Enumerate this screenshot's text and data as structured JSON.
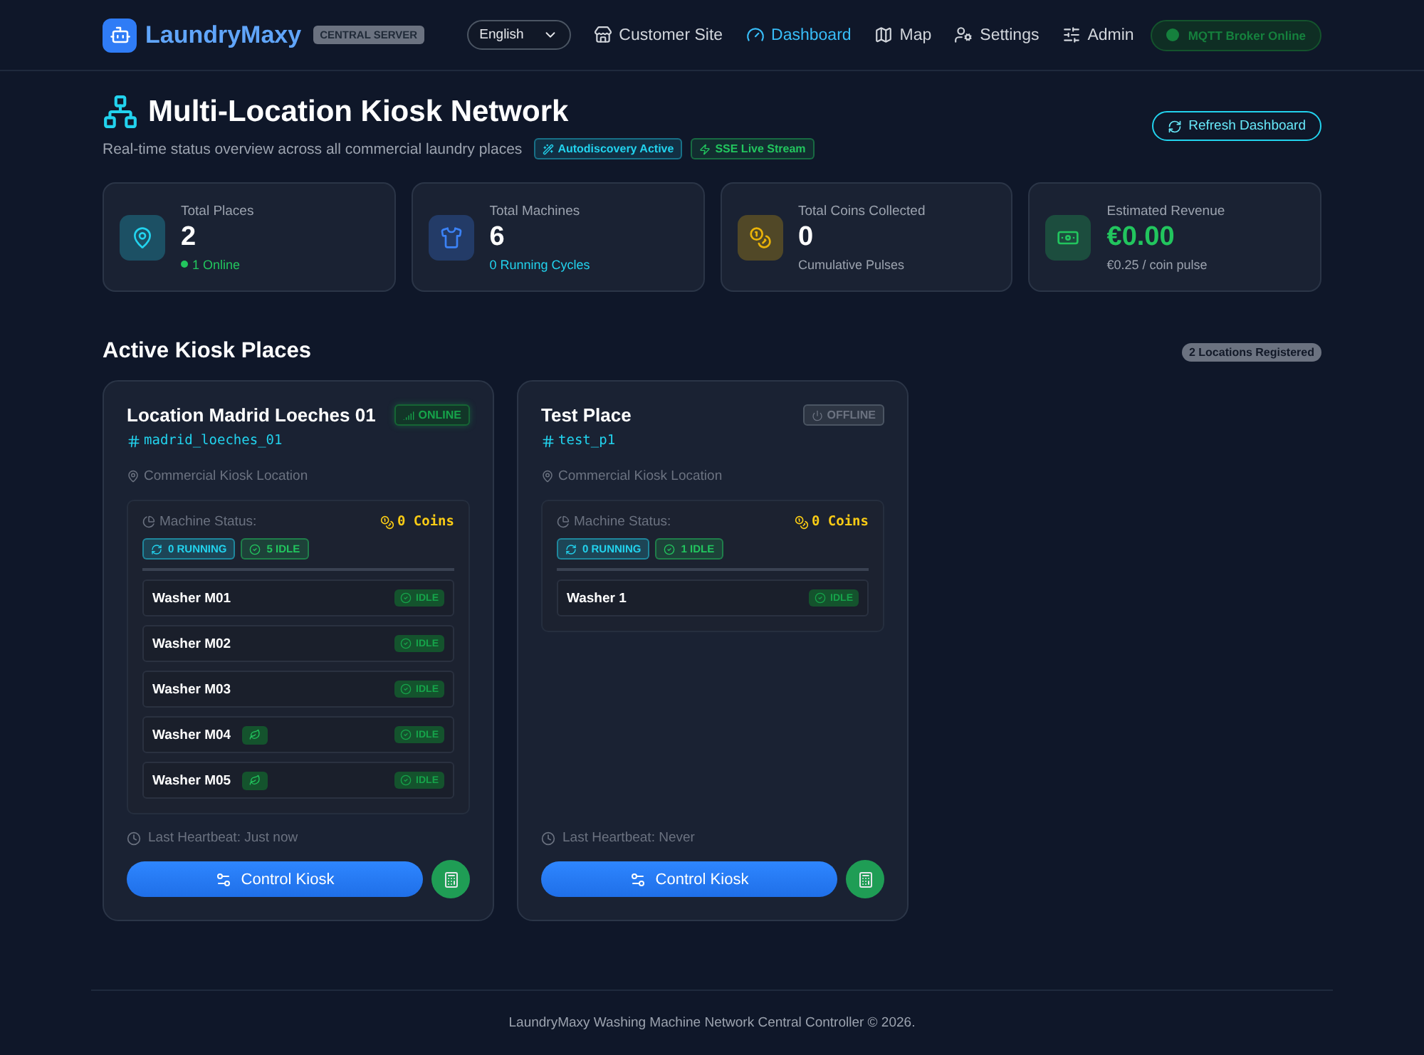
{
  "brand": {
    "name": "LaundryMaxy",
    "badge": "CENTRAL SERVER"
  },
  "language": {
    "value": "English"
  },
  "nav": [
    {
      "kind": "store",
      "label": "Customer Site",
      "selected": false
    },
    {
      "kind": "gauge",
      "label": "Dashboard",
      "selected": true
    },
    {
      "kind": "map",
      "label": "Map",
      "selected": false
    },
    {
      "kind": "settings",
      "label": "Settings",
      "selected": false
    },
    {
      "kind": "admin",
      "label": "Admin",
      "selected": false
    }
  ],
  "broker": {
    "label": "MQTT Broker Online",
    "online": true
  },
  "header": {
    "title": "Multi-Location Kiosk Network",
    "subtitle": "Real-time status overview across all commercial laundry places",
    "tags": [
      {
        "kind": "wand",
        "label": "Autodiscovery Active",
        "color": "#22d3ee"
      },
      {
        "kind": "zap",
        "label": "SSE Live Stream",
        "color": "#22c55e"
      }
    ],
    "refresh": "Refresh Dashboard"
  },
  "stats": [
    {
      "kind": "places",
      "label": "Total Places",
      "value": "2",
      "sub": "1 Online",
      "color": "#22d3ee"
    },
    {
      "kind": "machines",
      "label": "Total Machines",
      "value": "6",
      "sub": "0 Running Cycles",
      "color": "#3b82f6"
    },
    {
      "kind": "coins",
      "label": "Total Coins Collected",
      "value": "0",
      "sub": "Cumulative Pulses",
      "color": "#eab308"
    },
    {
      "kind": "revenue",
      "label": "Estimated Revenue",
      "value": "€0.00",
      "sub": "€0.25 / coin pulse",
      "color": "#22c55e"
    }
  ],
  "section": {
    "title": "Active Kiosk Places",
    "count": "2 Locations Registered"
  },
  "places": [
    {
      "name": "Location Madrid Loeches 01",
      "online": true,
      "status": "ONLINE",
      "id": "madrid_loeches_01",
      "location": "Commercial Kiosk Location",
      "machine_status": "Machine Status:",
      "coins": "0 Coins",
      "running": "0 RUNNING",
      "idle": "5 IDLE",
      "machines": [
        {
          "name": "Washer M01",
          "eco": false,
          "status": "IDLE"
        },
        {
          "name": "Washer M02",
          "eco": false,
          "status": "IDLE"
        },
        {
          "name": "Washer M03",
          "eco": false,
          "status": "IDLE"
        },
        {
          "name": "Washer M04",
          "eco": true,
          "status": "IDLE"
        },
        {
          "name": "Washer M05",
          "eco": true,
          "status": "IDLE"
        }
      ],
      "heartbeat": "Last Heartbeat: Just now",
      "control": "Control Kiosk"
    },
    {
      "name": "Test Place",
      "online": false,
      "status": "OFFLINE",
      "id": "test_p1",
      "location": "Commercial Kiosk Location",
      "machine_status": "Machine Status:",
      "coins": "0 Coins",
      "running": "0 RUNNING",
      "idle": "1 IDLE",
      "machines": [
        {
          "name": "Washer 1",
          "eco": false,
          "status": "IDLE"
        }
      ],
      "heartbeat": "Last Heartbeat: Never",
      "control": "Control Kiosk"
    }
  ],
  "footer": "LaundryMaxy Washing Machine Network Central Controller © 2026."
}
